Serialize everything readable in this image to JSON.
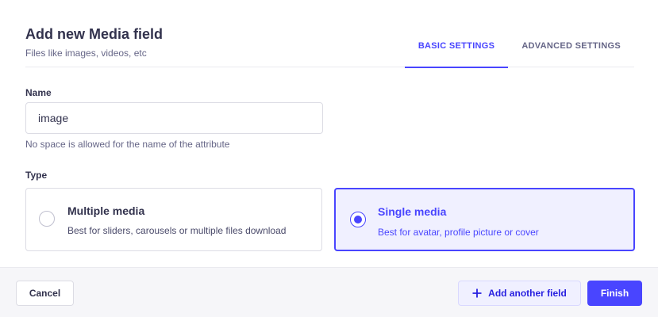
{
  "header": {
    "title": "Add new Media field",
    "subtitle": "Files like images, videos, etc",
    "tabs": [
      {
        "label": "BASIC SETTINGS",
        "active": true
      },
      {
        "label": "ADVANCED SETTINGS",
        "active": false
      }
    ]
  },
  "name_field": {
    "label": "Name",
    "value": "image",
    "hint": "No space is allowed for the name of the attribute"
  },
  "type_field": {
    "label": "Type",
    "options": [
      {
        "title": "Multiple media",
        "description": "Best for sliders, carousels or multiple files download",
        "selected": false
      },
      {
        "title": "Single media",
        "description": "Best for avatar, profile picture or cover",
        "selected": true
      }
    ]
  },
  "footer": {
    "cancel_label": "Cancel",
    "add_label": "Add another field",
    "finish_label": "Finish"
  },
  "colors": {
    "primary": "#4945ff",
    "primary_light": "#f0f0ff",
    "text": "#32324d",
    "muted": "#666687",
    "border": "#dcdce4",
    "footer_bg": "#f6f6f9"
  }
}
